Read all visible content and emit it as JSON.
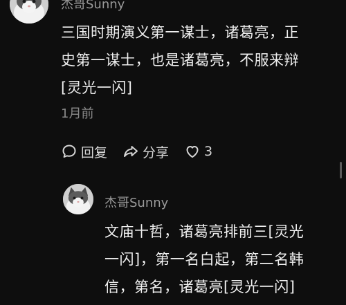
{
  "top_comment": {
    "username": "杰哥Sunny",
    "text_lines": [
      "三国时期演义第一谋士，诸葛亮，正",
      "史第一谋士，也是诸葛亮，不服来辩",
      "[灵光一闪]"
    ],
    "time": "1月前",
    "actions": {
      "reply_label": "回复",
      "share_label": "分享",
      "like_count": "3"
    }
  },
  "reply_comment": {
    "username": "杰哥Sunny",
    "text_lines": [
      "文庙十哲，诸葛亮排前三[灵光",
      "一闪]，第一名白起，第二名韩",
      "信，第名，诸葛亮[灵光一闪]"
    ]
  },
  "icons": {
    "reply": "comment-bubble-icon",
    "share": "share-arrow-icon",
    "like": "heart-outline-icon"
  },
  "colors": {
    "background": "#0e0e0e",
    "text": "#efefef",
    "secondary_text": "#9a9a9a"
  }
}
